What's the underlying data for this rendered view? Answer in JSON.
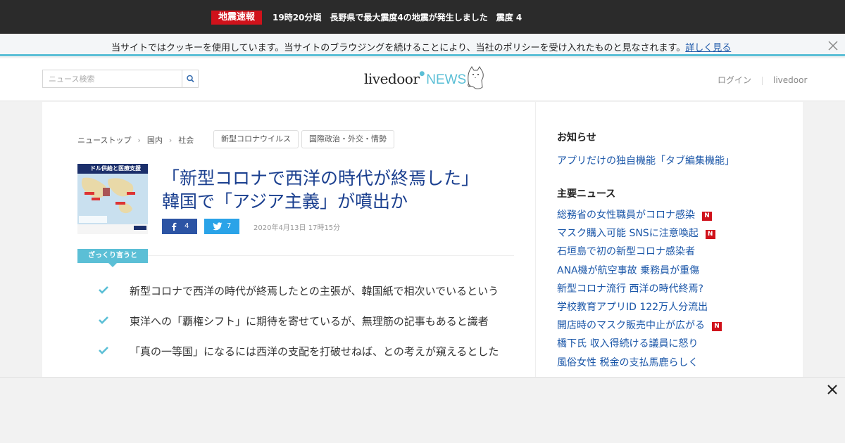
{
  "alert": {
    "badge": "地震速報",
    "text": "19時20分頃　長野県で最大震度4の地震が発生しました　震度 4"
  },
  "cookie": {
    "text": "当サイトではクッキーを使用しています。当サイトのブラウジングを続けることにより、当社のポリシーを受け入れたものと見なされます。",
    "link": "詳しく見る"
  },
  "header": {
    "search_placeholder": "ニュース検索",
    "logo_main": "livedoor",
    "logo_news": "NEWS",
    "login": "ログイン",
    "livedoor": "livedoor"
  },
  "breadcrumb": [
    "ニューストップ",
    "国内",
    "社会"
  ],
  "tags": [
    "新型コロナウイルス",
    "国際政治・外交・情勢"
  ],
  "article": {
    "title_line1": "「新型コロナで西洋の時代が終焉した」",
    "title_line2": "韓国で「アジア主義」が噴出か",
    "fb_count": "4",
    "tw_count": "7",
    "date": "2020年4月13日 17時15分",
    "summary_label": "ざっくり言うと",
    "points": [
      "新型コロナで西洋の時代が終焉したとの主張が、韓国紙で相次いでいるという",
      "東洋への「覇権シフト」に期待を寄せているが、無理筋の記事もあると識者",
      "「真の一等国」になるには西洋の支配を打破せねば、との考えが窺えるとした"
    ],
    "thumb_caption": "ドル供給と医療支援"
  },
  "sidebar": {
    "notice_head": "お知らせ",
    "notice_item": "アプリだけの独自機能「タブ編集機能」",
    "news_head": "主要ニュース",
    "news": [
      {
        "text": "総務省の女性職員がコロナ感染",
        "new": true
      },
      {
        "text": "マスク購入可能 SNSに注意喚起",
        "new": true
      },
      {
        "text": "石垣島で初の新型コロナ感染者",
        "new": false
      },
      {
        "text": "ANA機が航空事故 乗務員が重傷",
        "new": false
      },
      {
        "text": "新型コロナ流行 西洋の時代終焉?",
        "new": false
      },
      {
        "text": "学校教育アプリID 122万人分流出",
        "new": false
      },
      {
        "text": "開店時のマスク販売中止が広がる",
        "new": true
      },
      {
        "text": "橋下氏 収入得続ける議員に怒り",
        "new": false
      },
      {
        "text": "風俗女性 税金の支払馬鹿らしく",
        "new": false
      }
    ],
    "new_badge": "N"
  },
  "colors": {
    "accent": "#5bbfd6",
    "alert_red": "#d0121b",
    "link_blue": "#1a56a8",
    "title_blue": "#1a3f8f"
  }
}
